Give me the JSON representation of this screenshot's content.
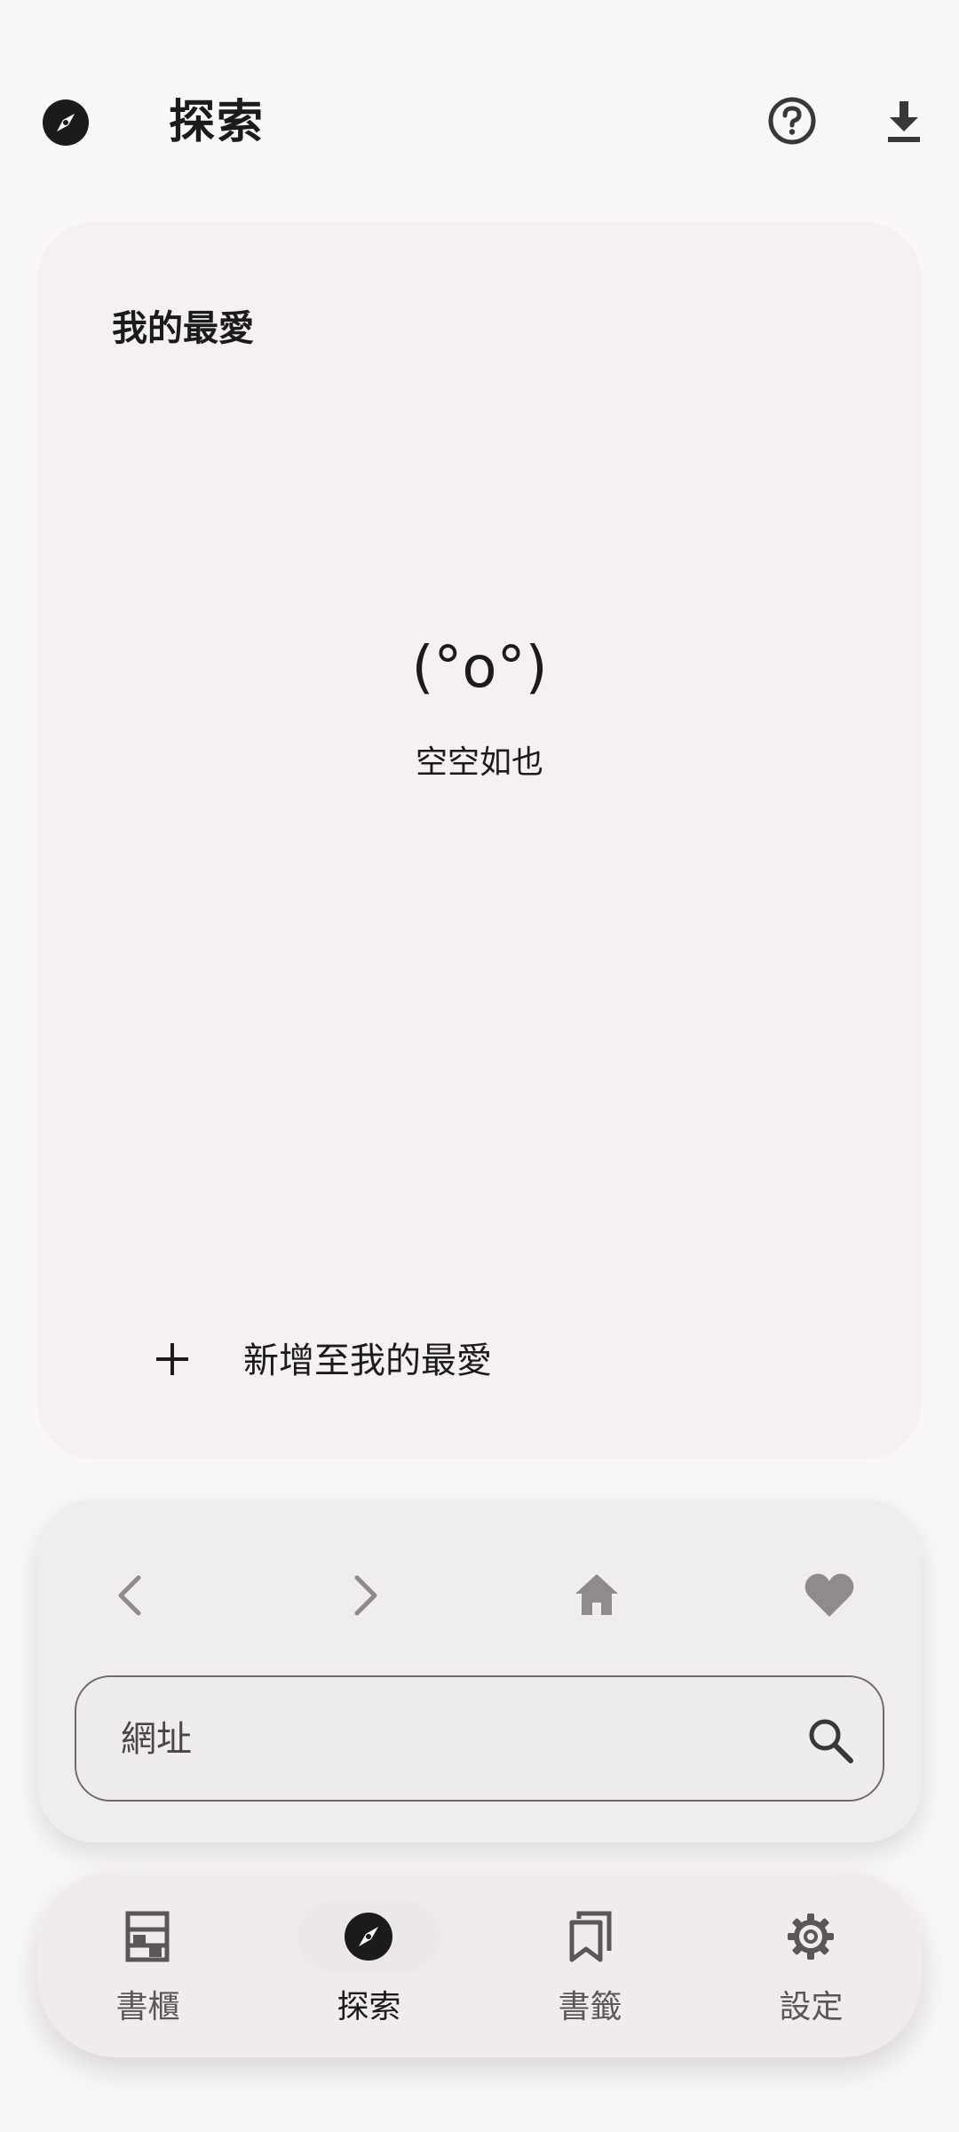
{
  "header": {
    "title": "探索",
    "app_icon": "compass-icon",
    "help_icon": "help-circle-icon",
    "download_icon": "download-icon"
  },
  "favorites": {
    "title": "我的最愛",
    "empty_face": "(°o°)",
    "empty_text": "空空如也",
    "add_label": "新增至我的最愛",
    "add_icon": "plus-icon"
  },
  "browser": {
    "back_icon": "chevron-left-icon",
    "forward_icon": "chevron-right-icon",
    "home_icon": "home-icon",
    "favorite_icon": "heart-icon",
    "url_placeholder": "網址",
    "url_value": "",
    "search_icon": "search-icon"
  },
  "bottom_nav": {
    "items": [
      {
        "label": "書櫃",
        "icon": "bookshelf-icon",
        "active": false
      },
      {
        "label": "探索",
        "icon": "compass-icon",
        "active": true
      },
      {
        "label": "書籤",
        "icon": "bookmarks-icon",
        "active": false
      },
      {
        "label": "設定",
        "icon": "gear-icon",
        "active": false
      }
    ]
  },
  "colors": {
    "background": "#f9f8f7",
    "card": "#f4f1f0",
    "panel": "#f0eeed",
    "text_primary": "#1c1b1b",
    "icon_muted": "#8f8b8b"
  }
}
